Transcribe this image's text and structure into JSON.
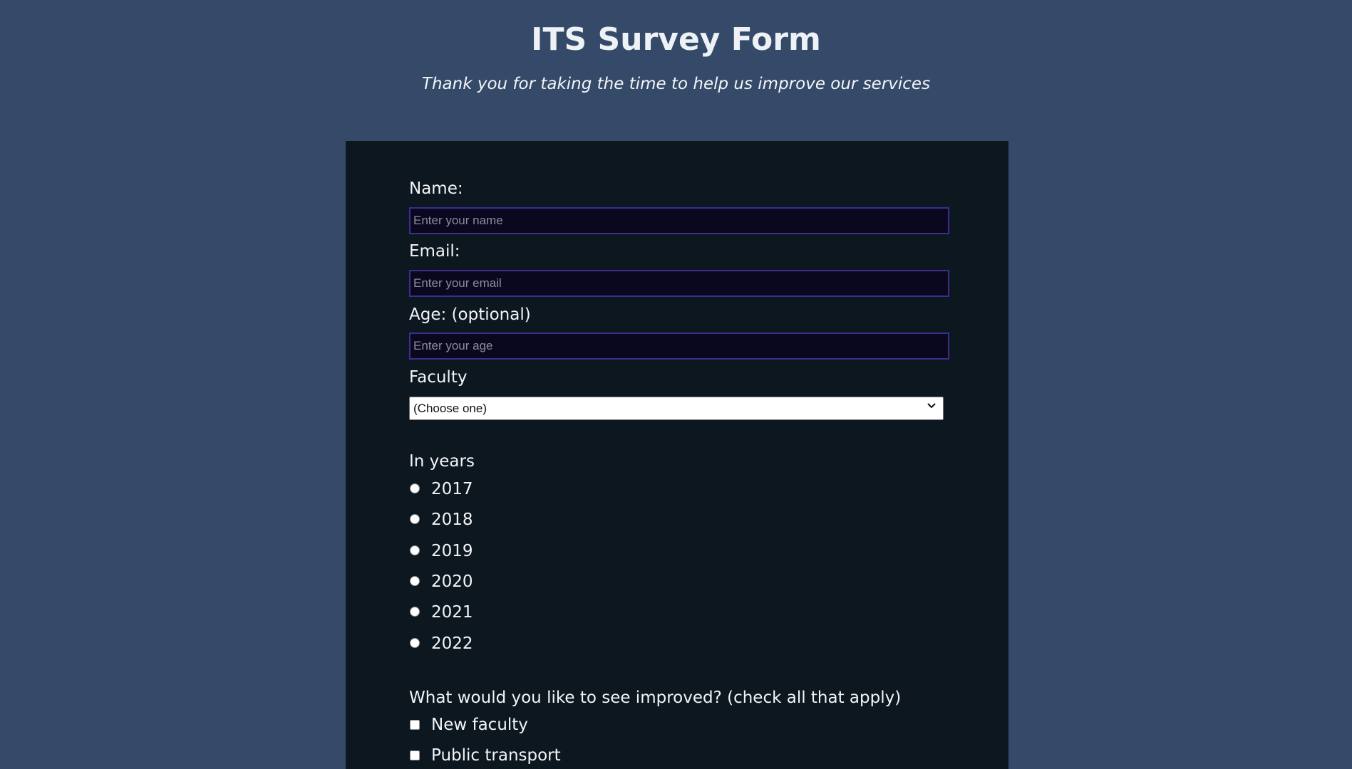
{
  "header": {
    "title": "ITS Survey Form",
    "subtitle": "Thank you for taking the time to help us improve our services"
  },
  "form": {
    "name_label": "Name:",
    "name_placeholder": "Enter your name",
    "email_label": "Email:",
    "email_placeholder": "Enter your email",
    "age_label": "Age: (optional)",
    "age_placeholder": "Enter your age",
    "faculty_label": "Faculty",
    "faculty_selected": "(Choose one)",
    "years_label": "In years",
    "years": [
      "2017",
      "2018",
      "2019",
      "2020",
      "2021",
      "2022"
    ],
    "improve_label": "What would you like to see improved? (check all that apply)",
    "improvements": [
      "New faculty",
      "Public transport"
    ]
  },
  "colors": {
    "page_background": "#344a68",
    "panel_background": "#0d1720",
    "input_background": "#09081e",
    "input_border": "#3b2e8e"
  }
}
